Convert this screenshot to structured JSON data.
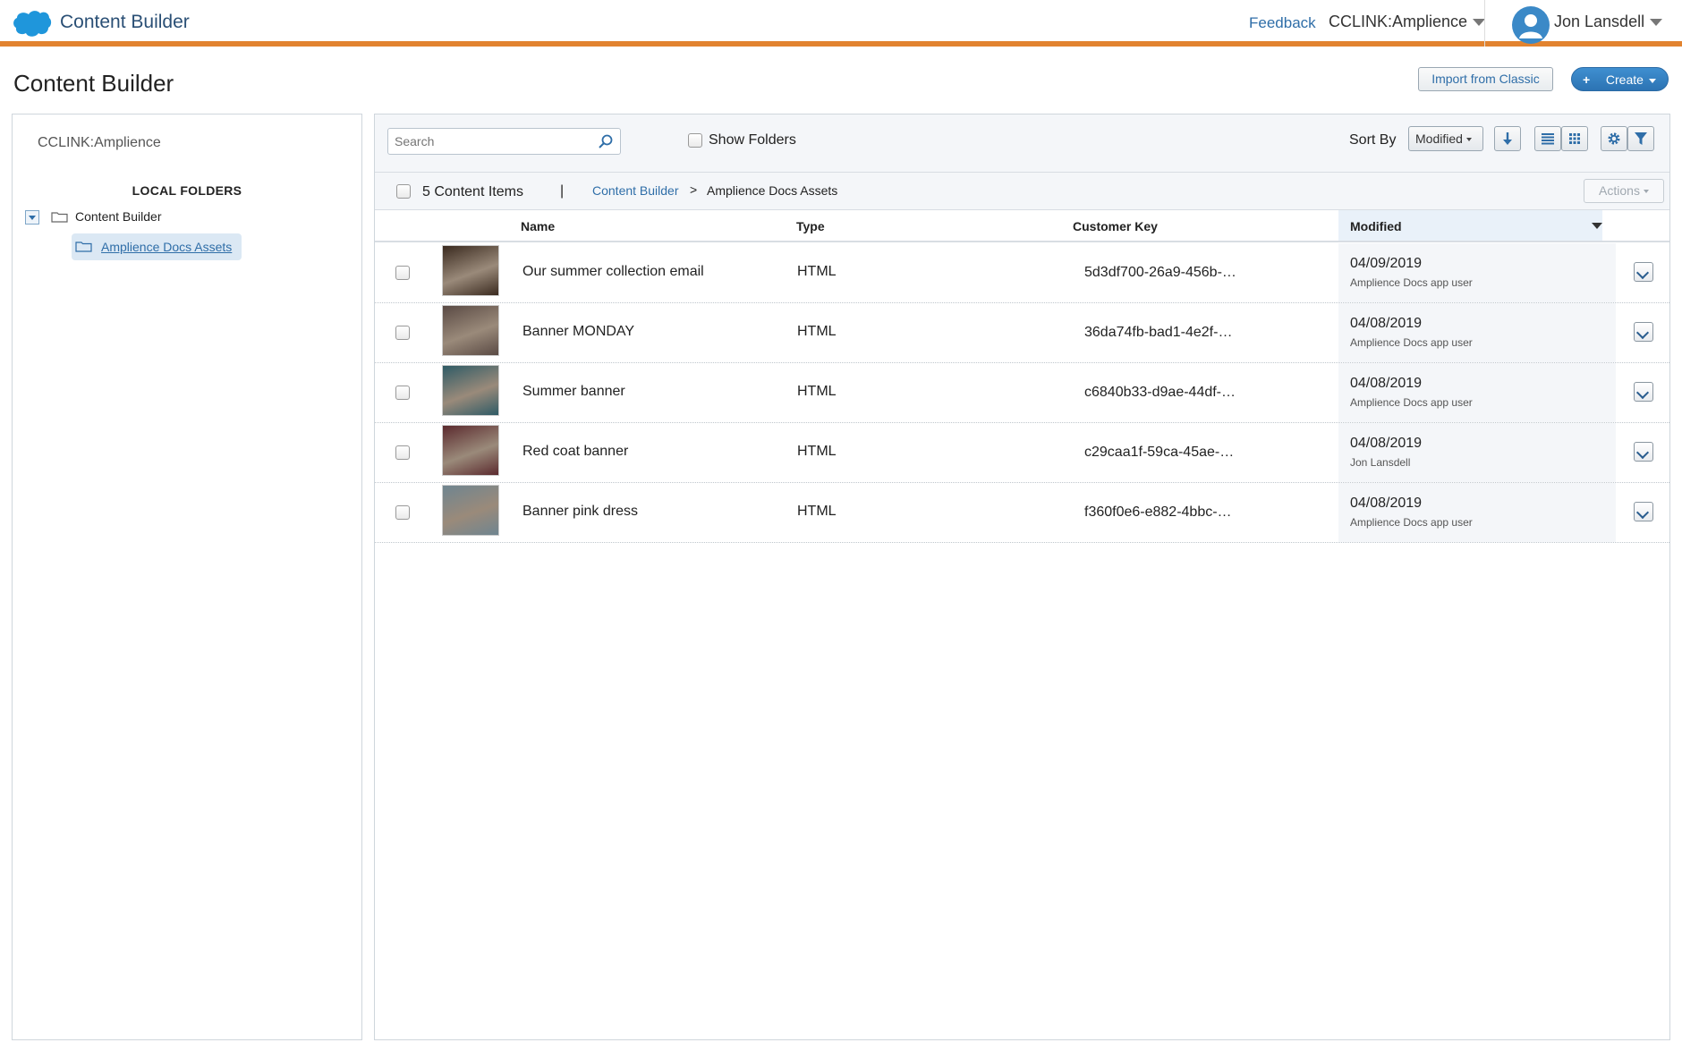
{
  "topbar": {
    "app_title": "Content Builder",
    "feedback": "Feedback",
    "business_unit": "CCLINK:Amplience",
    "user_name": "Jon Lansdell"
  },
  "page": {
    "title": "Content Builder",
    "import_button": "Import from Classic",
    "create_button": "Create"
  },
  "sidebar": {
    "business_unit": "CCLINK:Amplience",
    "section_title": "LOCAL FOLDERS",
    "root_folder": "Content Builder",
    "child_folder": "Amplience Docs Assets"
  },
  "toolbar": {
    "search_placeholder": "Search",
    "show_folders": "Show Folders",
    "sort_by_label": "Sort By",
    "sort_value": "Modified"
  },
  "breadcrumb": {
    "count_label": "5 Content Items",
    "separator": "|",
    "root": "Content Builder",
    "arrow": ">",
    "current": "Amplience Docs Assets",
    "actions": "Actions"
  },
  "table": {
    "headers": {
      "name": "Name",
      "type": "Type",
      "key": "Customer Key",
      "modified": "Modified"
    },
    "rows": [
      {
        "name": "Our summer collection email",
        "type": "HTML",
        "key": "5d3df700-26a9-456b-…",
        "date": "04/09/2019",
        "by": "Amplience Docs app user",
        "thumb_color": "#3a2a1f"
      },
      {
        "name": "Banner MONDAY",
        "type": "HTML",
        "key": "36da74fb-bad1-4e2f-…",
        "date": "04/08/2019",
        "by": "Amplience Docs app user",
        "thumb_color": "#5a4a44"
      },
      {
        "name": "Summer banner",
        "type": "HTML",
        "key": "c6840b33-d9ae-44df-…",
        "date": "04/08/2019",
        "by": "Amplience Docs app user",
        "thumb_color": "#2f5b66"
      },
      {
        "name": "Red coat banner",
        "type": "HTML",
        "key": "c29caa1f-59ca-45ae-…",
        "date": "04/08/2019",
        "by": "Jon Lansdell",
        "thumb_color": "#5b2a2e"
      },
      {
        "name": "Banner pink dress",
        "type": "HTML",
        "key": "f360f0e6-e882-4bbc-…",
        "date": "04/08/2019",
        "by": "Amplience Docs app user",
        "thumb_color": "#6f8590"
      }
    ]
  },
  "colors": {
    "accent_bar": "#e2832f",
    "link": "#2f6ea8",
    "create_button": "#2c73b3"
  }
}
